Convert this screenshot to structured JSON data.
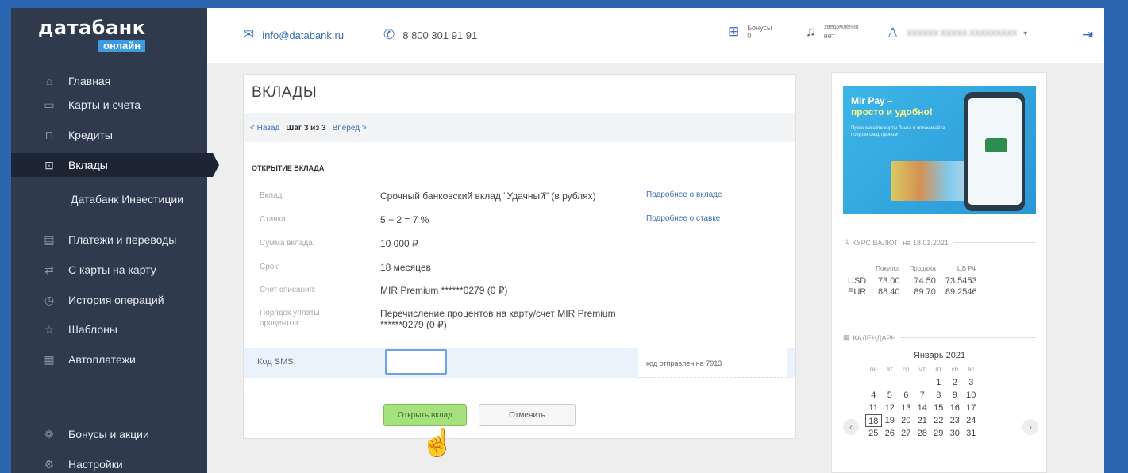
{
  "logo": {
    "main": "датабанк",
    "sub": "онлайн"
  },
  "sidebar": {
    "items": [
      {
        "label": "Главная",
        "icon": "home-icon"
      },
      {
        "label": "Карты и счета",
        "icon": "card-icon"
      },
      {
        "label": "Кредиты",
        "icon": "bag-icon"
      },
      {
        "label": "Вклады",
        "icon": "deposit-icon",
        "active": true
      },
      {
        "label": "Датабанк Инвестиции",
        "icon": ""
      },
      {
        "label": "Платежи и переводы",
        "icon": "document-icon"
      },
      {
        "label": "С карты на карту",
        "icon": "transfer-icon"
      },
      {
        "label": "История операций",
        "icon": "clock-icon"
      },
      {
        "label": "Шаблоны",
        "icon": "star-icon"
      },
      {
        "label": "Автоплатежи",
        "icon": "calendar-icon"
      },
      {
        "label": "Бонусы и акции",
        "icon": "gift-icon"
      },
      {
        "label": "Настройки",
        "icon": "gear-icon"
      }
    ]
  },
  "topbar": {
    "email": "info@databank.ru",
    "phone": "8 800 301 91 91",
    "bonus_label": "Бонусы",
    "bonus_value": "0",
    "notif_label": "Уведомления",
    "notif_value": "нет",
    "user_name": "ХХХХХХ ХХХХХ ХХХХХХХХХ"
  },
  "main": {
    "title": "ВКЛАДЫ",
    "back": "< Назад",
    "step": "Шаг 3 из 3",
    "forward": "Вперед >",
    "section": "ОТКРЫТИЕ ВКЛАДА",
    "rows": [
      {
        "label": "Вклад:",
        "value": "Срочный банковский вклад \"Удачный\" (в рублях)",
        "more": "Подробнее о вкладе"
      },
      {
        "label": "Ставка:",
        "value": "5 + 2 = 7 %",
        "more": "Подробнее о ставке"
      },
      {
        "label": "Сумма вклада:",
        "value": "10 000 ₽",
        "more": ""
      },
      {
        "label": "Срок:",
        "value": "18 месяцев",
        "more": ""
      },
      {
        "label": "Счет списания:",
        "value": "MIR Premium ******0279 (0 ₽)",
        "more": ""
      },
      {
        "label": "Порядок уплаты процентов:",
        "value": "Перечисление процентов на карту/счет MIR Premium ******0279 (0 ₽)",
        "more": ""
      }
    ],
    "sms_label": "Код SMS:",
    "sms_value": "",
    "sms_note": "код отправлен на 7913",
    "open_button": "Открыть вклад",
    "cancel_button": "Отменить"
  },
  "right": {
    "banner": {
      "title1": "Mir Pay –",
      "title2": "просто и удобно!",
      "text": "Привязывайте карты банка и оплачивайте покупки смартфоном"
    },
    "rates": {
      "title": "КУРС ВАЛЮТ",
      "date": "на 18.01.2021",
      "headers": [
        "Покупка",
        "Продажа",
        "ЦБ РФ"
      ],
      "rows": [
        {
          "cur": "USD",
          "buy": "73.00",
          "sell": "74.50",
          "cb": "73.5453"
        },
        {
          "cur": "EUR",
          "buy": "88.40",
          "sell": "89.70",
          "cb": "89.2546"
        }
      ]
    },
    "calendar": {
      "title": "КАЛЕНДАРЬ",
      "month": "Январь 2021",
      "dow": [
        "пн",
        "вт",
        "ср",
        "чт",
        "пт",
        "сб",
        "вс"
      ],
      "weeks": [
        [
          "",
          "",
          "",
          "",
          "1",
          "2",
          "3"
        ],
        [
          "4",
          "5",
          "6",
          "7",
          "8",
          "9",
          "10"
        ],
        [
          "11",
          "12",
          "13",
          "14",
          "15",
          "16",
          "17"
        ],
        [
          "18",
          "19",
          "20",
          "21",
          "22",
          "23",
          "24"
        ],
        [
          "25",
          "26",
          "27",
          "28",
          "29",
          "30",
          "31"
        ]
      ],
      "today": "18"
    }
  },
  "colors": {
    "sidebar": "#2f3a4d",
    "accent": "#3b6fb6",
    "open_button": "#a6e07f"
  }
}
